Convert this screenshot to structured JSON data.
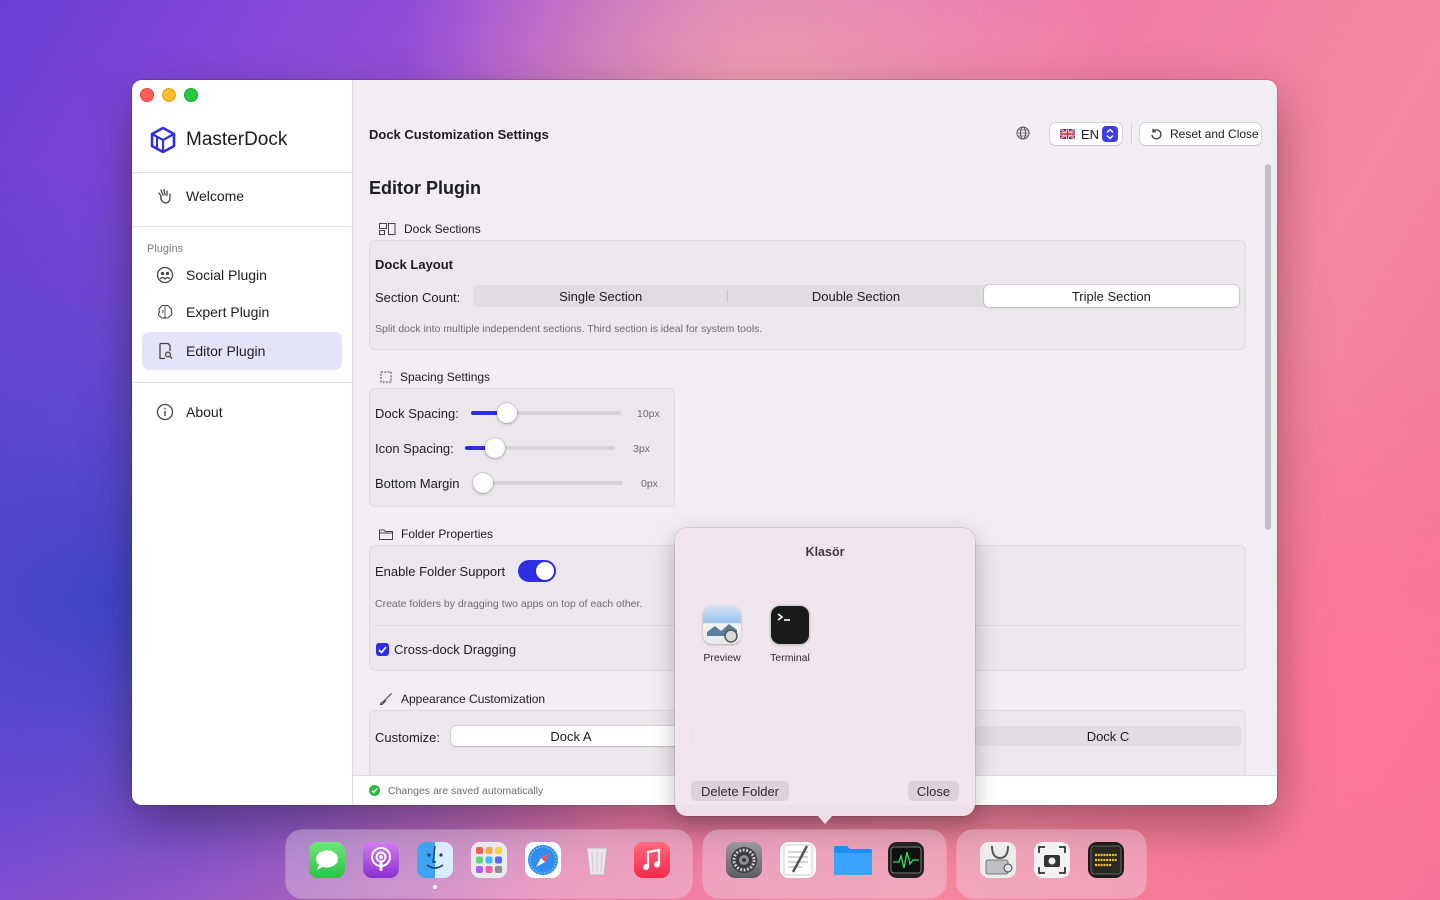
{
  "app": {
    "name": "MasterDock"
  },
  "sidebar": {
    "items": [
      {
        "label": "Welcome",
        "icon": "hand-wave-icon"
      },
      {
        "label": "Social Plugin",
        "icon": "social-icon"
      },
      {
        "label": "Expert Plugin",
        "icon": "brain-icon"
      },
      {
        "label": "Editor Plugin",
        "icon": "doc-search-icon",
        "active": true
      },
      {
        "label": "About",
        "icon": "info-icon"
      }
    ],
    "section_label": "Plugins"
  },
  "header": {
    "title": "Dock Customization Settings",
    "language": "EN",
    "reset_label": "Reset and Close"
  },
  "page": {
    "title": "Editor Plugin"
  },
  "dock_sections": {
    "heading": "Dock Sections",
    "layout_title": "Dock Layout",
    "count_label": "Section Count:",
    "options": [
      "Single Section",
      "Double Section",
      "Triple Section"
    ],
    "selected": "Triple Section",
    "hint": "Split dock into multiple independent sections. Third section is ideal for system tools."
  },
  "spacing": {
    "heading": "Spacing Settings",
    "sliders": [
      {
        "label": "Dock Spacing:",
        "value": "10px",
        "fraction": 0.24
      },
      {
        "label": "Icon Spacing:",
        "value": "3px",
        "fraction": 0.2
      },
      {
        "label": "Bottom Margin",
        "value": "0px",
        "fraction": 0.0
      }
    ]
  },
  "folder": {
    "heading": "Folder Properties",
    "enable_label": "Enable Folder Support",
    "enabled": true,
    "hint": "Create folders by dragging two apps on top of each other.",
    "cross_label": "Cross-dock Dragging",
    "cross_checked": true
  },
  "appearance": {
    "heading": "Appearance Customization",
    "customize_label": "Customize:",
    "options": [
      "Dock A",
      "Dock C"
    ]
  },
  "status": {
    "text": "Changes are saved automatically"
  },
  "popover": {
    "title": "Klasör",
    "apps": [
      {
        "name": "Preview",
        "icon": "preview-icon"
      },
      {
        "name": "Terminal",
        "icon": "terminal-icon"
      }
    ],
    "delete_label": "Delete Folder",
    "close_label": "Close"
  },
  "dock": {
    "apps": [
      "messages-icon",
      "podcasts-icon",
      "finder-icon",
      "launchpad-icon",
      "safari-icon",
      "trash-icon",
      "music-icon",
      "settings-icon",
      "textedit-icon",
      "folder-icon",
      "activity-monitor-icon",
      "disk-utility-icon",
      "screenshot-icon",
      "console-icon"
    ]
  },
  "colors": {
    "accent": "#2d2fe0",
    "active_nav": "#e3e4f8"
  }
}
